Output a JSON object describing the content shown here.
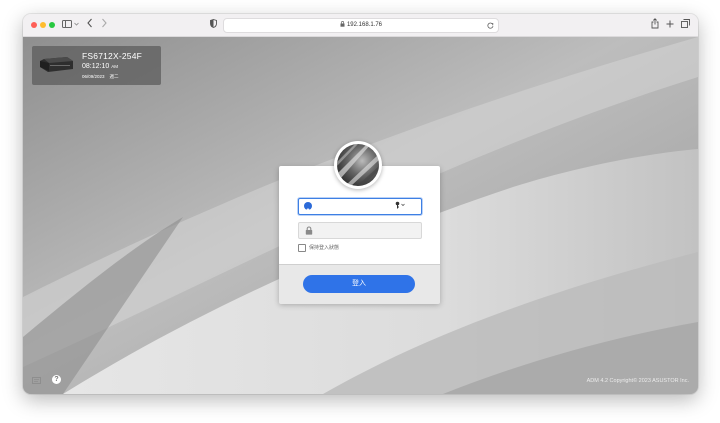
{
  "browser": {
    "address": "192.168.1.76",
    "colors": {
      "close": "#fe5f57",
      "minimize": "#febc2e",
      "maximize": "#28c840"
    },
    "icons": [
      "sidebar-icon",
      "chevron-down-icon",
      "back-icon",
      "forward-icon",
      "shield-icon",
      "lock-icon",
      "reload-icon",
      "share-icon",
      "new-tab-icon",
      "tabs-overview-icon"
    ]
  },
  "device": {
    "name": "FS6712X-254F",
    "time": "08:12:10",
    "ampm": "AM",
    "date": "06/09/2023",
    "weekday": "週二"
  },
  "login": {
    "username_value": "",
    "username_placeholder": "",
    "password_value": "",
    "password_placeholder": "",
    "remember_label": "保持登入狀態",
    "remember_checked": false,
    "button_label": "登入"
  },
  "footer": {
    "copyright": "ADM 4.2 Copyright© 2023 ASUSTOR Inc.",
    "help_glyph": "?"
  },
  "theme": {
    "accent": "#2f73e8",
    "focus_border": "#3d7fe4",
    "user_icon": "#2c6ad8"
  }
}
